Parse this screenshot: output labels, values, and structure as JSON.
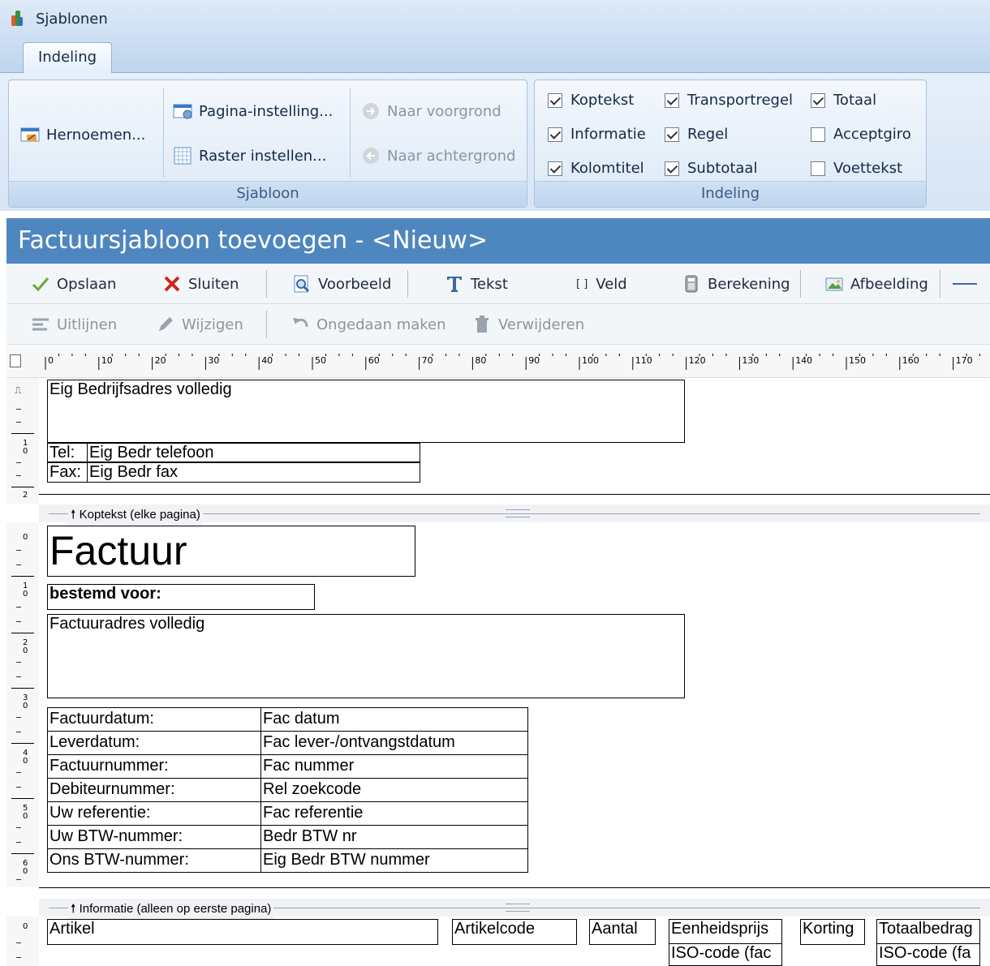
{
  "window": {
    "title": "Sjablonen"
  },
  "ribbon": {
    "tab": "Indeling",
    "sjabloon_group": {
      "label": "Sjabloon",
      "rename": "Hernoemen...",
      "page_setup": "Pagina-instelling...",
      "grid_setup": "Raster instellen...",
      "to_front": "Naar voorgrond",
      "to_back": "Naar achtergrond"
    },
    "indeling_group": {
      "label": "Indeling",
      "checks": [
        {
          "label": "Koptekst",
          "checked": true
        },
        {
          "label": "Informatie",
          "checked": true
        },
        {
          "label": "Kolomtitel",
          "checked": true
        },
        {
          "label": "Transportregel",
          "checked": true
        },
        {
          "label": "Regel",
          "checked": true
        },
        {
          "label": "Subtotaal",
          "checked": true
        },
        {
          "label": "Totaal",
          "checked": true
        },
        {
          "label": "Acceptgiro",
          "checked": false
        },
        {
          "label": "Voettekst",
          "checked": false
        }
      ]
    }
  },
  "form": {
    "title": "Factuursjabloon toevoegen - <Nieuw>"
  },
  "toolbar1": {
    "save": "Opslaan",
    "close": "Sluiten",
    "preview": "Voorbeeld",
    "text": "Tekst",
    "field": "Veld",
    "field_glyph": "[ ]",
    "calc": "Berekening",
    "image": "Afbeelding"
  },
  "toolbar2": {
    "align": "Uitlijnen",
    "edit": "Wijzigen",
    "undo": "Ongedaan maken",
    "delete": "Verwijderen"
  },
  "ruler": {
    "h_ticks": [
      "0",
      "10",
      "20",
      "30",
      "40",
      "50",
      "60",
      "70",
      "80",
      "90",
      "100",
      "110",
      "120",
      "130",
      "140",
      "150",
      "160",
      "170"
    ]
  },
  "sections": {
    "header_band": "Koptekst (elke pagina)",
    "info_band": "Informatie (alleen op eerste pagina)"
  },
  "template": {
    "company_address": "Eig Bedrijfsadres volledig",
    "tel_label": "Tel:",
    "tel_value": "Eig Bedr telefoon",
    "fax_label": "Fax:",
    "fax_value": "Eig Bedr fax",
    "invoice_title": "Factuur",
    "intended_for": "bestemd voor:",
    "invoice_address": "Factuuradres volledig",
    "rows": [
      {
        "label": "Factuurdatum:",
        "value": "Fac datum"
      },
      {
        "label": "Leverdatum:",
        "value": "Fac lever-/ontvangstdatum"
      },
      {
        "label": "Factuurnummer:",
        "value": "Fac nummer"
      },
      {
        "label": "Debiteurnummer:",
        "value": "Rel zoekcode"
      },
      {
        "label": "Uw referentie:",
        "value": "Fac referentie"
      },
      {
        "label": "Uw BTW-nummer:",
        "value": "Bedr BTW nr"
      },
      {
        "label": "Ons BTW-nummer:",
        "value": "Eig Bedr BTW nummer"
      }
    ],
    "columns": {
      "article": "Artikel",
      "article_code": "Artikelcode",
      "quantity": "Aantal",
      "unit_price": "Eenheidsprijs",
      "iso_code_1": "ISO-code (fac",
      "discount": "Korting",
      "total_amount": "Totaalbedrag",
      "iso_code_2": "ISO-code (fa"
    }
  }
}
